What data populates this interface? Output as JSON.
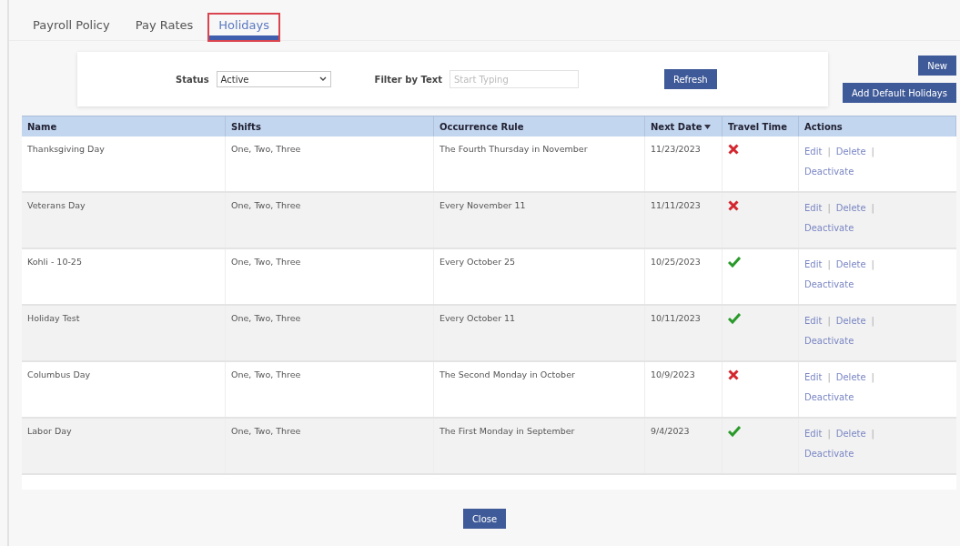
{
  "tabs": [
    {
      "label": "Payroll Policy",
      "selected": false
    },
    {
      "label": "Pay Rates",
      "selected": false
    },
    {
      "label": "Holidays",
      "selected": true
    }
  ],
  "filters": {
    "status_label": "Status",
    "status_value": "Active",
    "text_label": "Filter by Text",
    "text_placeholder": "Start Typing",
    "refresh": "Refresh"
  },
  "buttons": {
    "new": "New",
    "add_default": "Add Default Holidays",
    "close": "Close"
  },
  "table": {
    "columns": [
      {
        "label": "Name",
        "sorted": false
      },
      {
        "label": "Shifts",
        "sorted": false
      },
      {
        "label": "Occurrence Rule",
        "sorted": false
      },
      {
        "label": "Next Date",
        "sorted": true
      },
      {
        "label": "Travel Time",
        "sorted": false
      },
      {
        "label": "Actions",
        "sorted": false
      }
    ],
    "rows": [
      {
        "name": "Thanksgiving Day",
        "shifts": "One, Two, Three",
        "rule": "The Fourth Thursday in November",
        "next_date": "11/23/2023",
        "travel_time": false,
        "actions": [
          {
            "kind": "link",
            "label": "Edit"
          },
          {
            "kind": "separator",
            "label": "|"
          },
          {
            "kind": "link",
            "label": "Delete"
          },
          {
            "kind": "separator",
            "label": "|"
          },
          {
            "kind": "link",
            "label": "Deactivate"
          }
        ]
      },
      {
        "name": "Veterans Day",
        "shifts": "One, Two, Three",
        "rule": "Every November 11",
        "next_date": "11/11/2023",
        "travel_time": false,
        "actions": [
          {
            "kind": "link",
            "label": "Edit"
          },
          {
            "kind": "separator",
            "label": "|"
          },
          {
            "kind": "link",
            "label": "Delete"
          },
          {
            "kind": "separator",
            "label": "|"
          },
          {
            "kind": "link",
            "label": "Deactivate"
          }
        ]
      },
      {
        "name": "Kohli - 10-25",
        "shifts": "One, Two, Three",
        "rule": "Every October 25",
        "next_date": "10/25/2023",
        "travel_time": true,
        "actions": [
          {
            "kind": "link",
            "label": "Edit"
          },
          {
            "kind": "separator",
            "label": "|"
          },
          {
            "kind": "link",
            "label": "Delete"
          },
          {
            "kind": "separator",
            "label": "|"
          },
          {
            "kind": "link",
            "label": "Deactivate"
          }
        ]
      },
      {
        "name": "Holiday Test",
        "shifts": "One, Two, Three",
        "rule": "Every October 11",
        "next_date": "10/11/2023",
        "travel_time": true,
        "actions": [
          {
            "kind": "link",
            "label": "Edit"
          },
          {
            "kind": "separator",
            "label": "|"
          },
          {
            "kind": "link",
            "label": "Delete"
          },
          {
            "kind": "separator",
            "label": "|"
          },
          {
            "kind": "link",
            "label": "Deactivate"
          }
        ]
      },
      {
        "name": "Columbus Day",
        "shifts": "One, Two, Three",
        "rule": "The Second Monday in October",
        "next_date": "10/9/2023",
        "travel_time": false,
        "actions": [
          {
            "kind": "link",
            "label": "Edit"
          },
          {
            "kind": "separator",
            "label": "|"
          },
          {
            "kind": "link",
            "label": "Delete"
          },
          {
            "kind": "separator",
            "label": "|"
          },
          {
            "kind": "link",
            "label": "Deactivate"
          }
        ]
      },
      {
        "name": "Labor Day",
        "shifts": "One, Two, Three",
        "rule": "The First Monday in September",
        "next_date": "9/4/2023",
        "travel_time": true,
        "actions": [
          {
            "kind": "link",
            "label": "Edit"
          },
          {
            "kind": "separator",
            "label": "|"
          },
          {
            "kind": "link",
            "label": "Delete"
          },
          {
            "kind": "separator",
            "label": "|"
          },
          {
            "kind": "link",
            "label": "Deactivate"
          }
        ]
      }
    ]
  }
}
